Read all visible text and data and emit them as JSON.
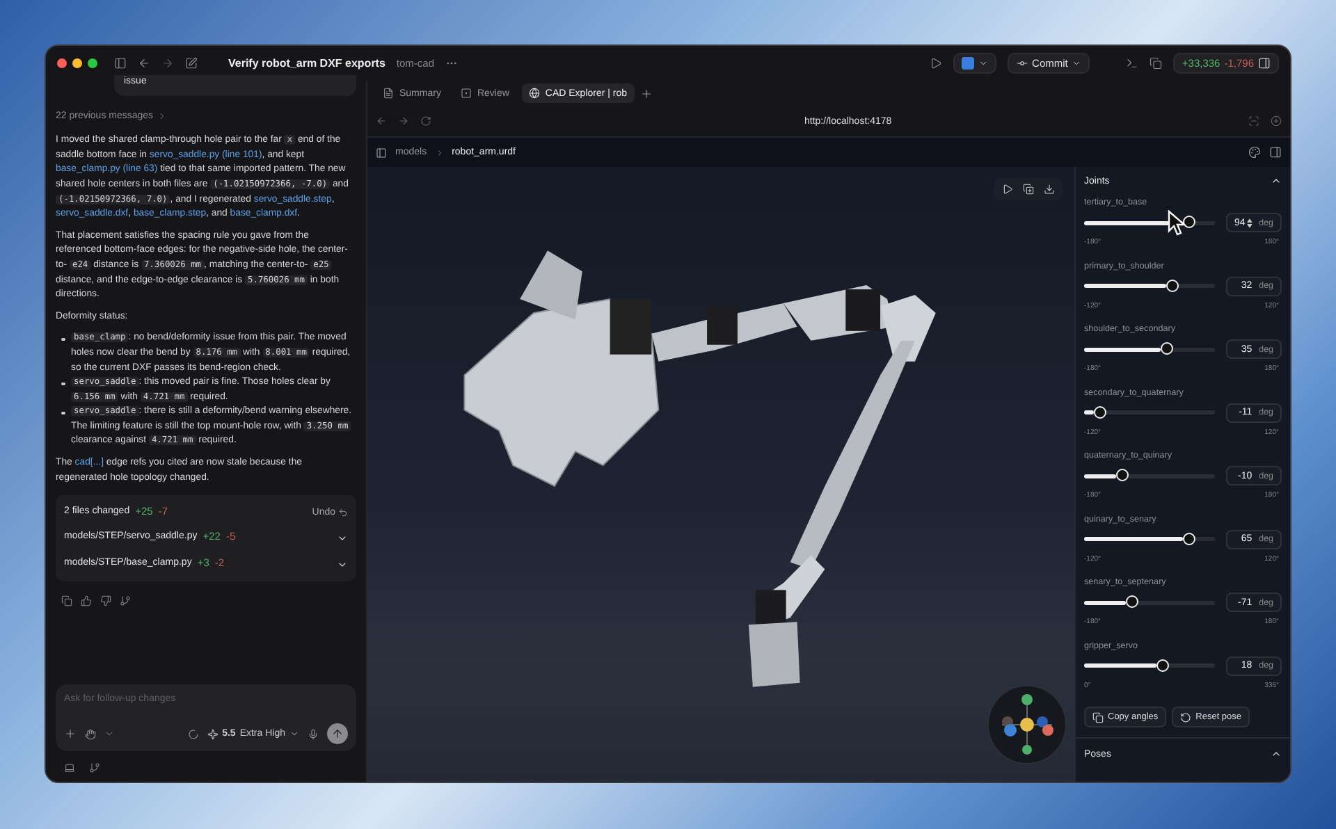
{
  "window": {
    "title": "Verify robot_arm DXF exports",
    "project": "tom-cad"
  },
  "toolbar": {
    "commit": "Commit",
    "additions": "+33,336",
    "deletions": "-1,796"
  },
  "chat": {
    "previous_bubble": "issue",
    "previous_messages": "22 previous messages",
    "paragraphs": [
      [
        {
          "kind": "text",
          "text": "I moved the shared clamp-through hole pair to the far "
        },
        {
          "kind": "code",
          "text": "x"
        },
        {
          "kind": "text",
          "text": " end of the saddle bottom face in "
        },
        {
          "kind": "link",
          "text": "servo_saddle.py (line 101)"
        },
        {
          "kind": "text",
          "text": ", and kept "
        },
        {
          "kind": "link",
          "text": "base_clamp.py (line 63)"
        },
        {
          "kind": "text",
          "text": " tied to that same imported pattern. The new shared hole centers in both files are "
        },
        {
          "kind": "code",
          "text": "(-1.02150972366, -7.0)"
        },
        {
          "kind": "text",
          "text": " and "
        },
        {
          "kind": "code",
          "text": "(-1.02150972366, 7.0)"
        },
        {
          "kind": "text",
          "text": ", and I regenerated "
        },
        {
          "kind": "link",
          "text": "servo_saddle.step"
        },
        {
          "kind": "text",
          "text": ", "
        },
        {
          "kind": "link",
          "text": "servo_saddle.dxf"
        },
        {
          "kind": "text",
          "text": ", "
        },
        {
          "kind": "link",
          "text": "base_clamp.step"
        },
        {
          "kind": "text",
          "text": ", and "
        },
        {
          "kind": "link",
          "text": "base_clamp.dxf"
        },
        {
          "kind": "text",
          "text": "."
        }
      ],
      [
        {
          "kind": "text",
          "text": "That placement satisfies the spacing rule you gave from the referenced bottom-face edges: for the negative-side hole, the center-to- "
        },
        {
          "kind": "code",
          "text": "e24"
        },
        {
          "kind": "text",
          "text": " distance is "
        },
        {
          "kind": "code",
          "text": "7.360026 mm"
        },
        {
          "kind": "text",
          "text": ", matching the center-to- "
        },
        {
          "kind": "code",
          "text": "e25"
        },
        {
          "kind": "text",
          "text": " distance, and the edge-to-edge clearance is "
        },
        {
          "kind": "code",
          "text": "5.760026 mm"
        },
        {
          "kind": "text",
          "text": " in both directions."
        }
      ],
      [
        {
          "kind": "text",
          "text": "Deformity status:"
        }
      ]
    ],
    "bullets": [
      [
        {
          "kind": "code",
          "text": "base_clamp"
        },
        {
          "kind": "text",
          "text": ": no bend/deformity issue from this pair. The moved holes now clear the bend by "
        },
        {
          "kind": "code",
          "text": "8.176 mm"
        },
        {
          "kind": "text",
          "text": " with "
        },
        {
          "kind": "code",
          "text": "8.001 mm"
        },
        {
          "kind": "text",
          "text": " required, so the current DXF passes its bend-region check."
        }
      ],
      [
        {
          "kind": "code",
          "text": "servo_saddle"
        },
        {
          "kind": "text",
          "text": ": this moved pair is fine. Those holes clear by "
        },
        {
          "kind": "code",
          "text": "6.156 mm"
        },
        {
          "kind": "text",
          "text": " with "
        },
        {
          "kind": "code",
          "text": "4.721 mm"
        },
        {
          "kind": "text",
          "text": " required."
        }
      ],
      [
        {
          "kind": "code",
          "text": "servo_saddle"
        },
        {
          "kind": "text",
          "text": ": there is still a deformity/bend warning elsewhere. The limiting feature is still the top mount-hole row, with "
        },
        {
          "kind": "code",
          "text": "3.250 mm"
        },
        {
          "kind": "text",
          "text": " clearance against "
        },
        {
          "kind": "code",
          "text": "4.721 mm"
        },
        {
          "kind": "text",
          "text": " required."
        }
      ]
    ],
    "closing": [
      {
        "kind": "text",
        "text": "The "
      },
      {
        "kind": "link",
        "text": "cad[...]"
      },
      {
        "kind": "text",
        "text": " edge refs you cited are now stale because the regenerated hole topology changed."
      }
    ],
    "changes": {
      "summary": "2 files changed",
      "added": "+25",
      "removed": "-7",
      "undo": "Undo",
      "files": [
        {
          "path": "models/STEP/servo_saddle.py",
          "added": "+22",
          "removed": "-5"
        },
        {
          "path": "models/STEP/base_clamp.py",
          "added": "+3",
          "removed": "-2"
        }
      ]
    },
    "composer": {
      "placeholder": "Ask for follow-up changes",
      "model": "5.5",
      "effort": "Extra High"
    }
  },
  "browser": {
    "tabs": [
      {
        "label": "Summary",
        "selected": false
      },
      {
        "label": "Review",
        "selected": false
      },
      {
        "label": "CAD Explorer | rob",
        "selected": true
      }
    ],
    "url": "http://localhost:4178",
    "breadcrumb": [
      "models",
      "robot_arm.urdf"
    ]
  },
  "joints": {
    "title": "Joints",
    "items": [
      {
        "name": "tertiary_to_base",
        "level": 0.76,
        "value": "94",
        "unit": "deg",
        "min": "-180°",
        "max": "180°",
        "focused": true
      },
      {
        "name": "primary_to_shoulder",
        "level": 0.63,
        "value": "32",
        "unit": "deg",
        "min": "-120°",
        "max": "120°",
        "focused": false
      },
      {
        "name": "shoulder_to_secondary",
        "level": 0.59,
        "value": "35",
        "unit": "deg",
        "min": "-180°",
        "max": "180°",
        "focused": false
      },
      {
        "name": "secondary_to_quaternary",
        "level": 0.07,
        "value": "-11",
        "unit": "deg",
        "min": "-120°",
        "max": "120°",
        "focused": false
      },
      {
        "name": "quaternary_to_quinary",
        "level": 0.24,
        "value": "-10",
        "unit": "deg",
        "min": "-180°",
        "max": "180°",
        "focused": false
      },
      {
        "name": "quinary_to_senary",
        "level": 0.75,
        "value": "65",
        "unit": "deg",
        "min": "-120°",
        "max": "120°",
        "focused": false
      },
      {
        "name": "senary_to_septenary",
        "level": 0.32,
        "value": "-71",
        "unit": "deg",
        "min": "-180°",
        "max": "180°",
        "focused": false
      },
      {
        "name": "gripper_servo",
        "level": 0.55,
        "value": "18",
        "unit": "deg",
        "min": "0°",
        "max": "335°",
        "focused": false
      }
    ],
    "buttons": [
      "Copy angles",
      "Reset pose"
    ]
  },
  "poses": {
    "title": "Poses"
  }
}
